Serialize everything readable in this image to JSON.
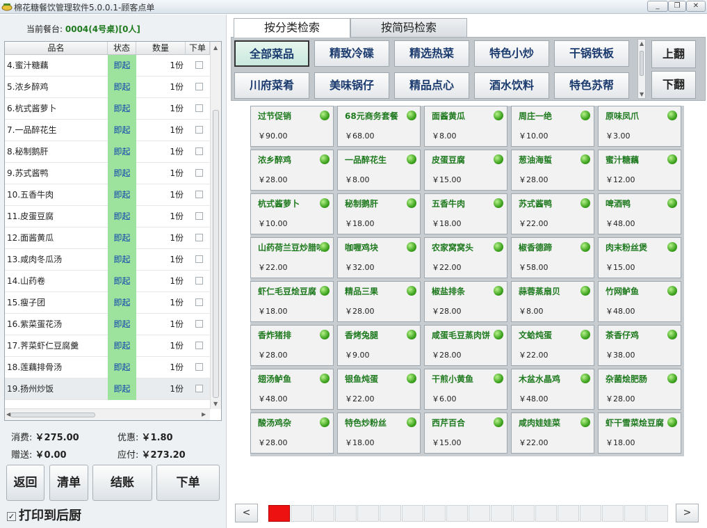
{
  "window": {
    "title": "棉花糖餐饮管理软件5.0.0.1-顾客点单",
    "minimize": "_",
    "restore": "❐",
    "close": "✕"
  },
  "order": {
    "table_label": "当前餐台:",
    "table_value": "0004(4号桌)[0人]",
    "columns": [
      "品名",
      "状态",
      "数量",
      "下单"
    ],
    "rows": [
      {
        "name": "4.蜜汁糖藕",
        "status": "即起",
        "qty": "1份"
      },
      {
        "name": "5.浓乡醉鸡",
        "status": "即起",
        "qty": "1份"
      },
      {
        "name": "6.杭式酱萝卜",
        "status": "即起",
        "qty": "1份"
      },
      {
        "name": "7.一品醉花生",
        "status": "即起",
        "qty": "1份"
      },
      {
        "name": "8.秘制鹅肝",
        "status": "即起",
        "qty": "1份"
      },
      {
        "name": "9.苏式酱鸭",
        "status": "即起",
        "qty": "1份"
      },
      {
        "name": "10.五香牛肉",
        "status": "即起",
        "qty": "1份"
      },
      {
        "name": "11.皮蛋豆腐",
        "status": "即起",
        "qty": "1份"
      },
      {
        "name": "12.面酱黄瓜",
        "status": "即起",
        "qty": "1份"
      },
      {
        "name": "13.咸肉冬瓜汤",
        "status": "即起",
        "qty": "1份"
      },
      {
        "name": "14.山药卷",
        "status": "即起",
        "qty": "1份"
      },
      {
        "name": "15.瘦子团",
        "status": "即起",
        "qty": "1份"
      },
      {
        "name": "16.紫菜蛋花汤",
        "status": "即起",
        "qty": "1份"
      },
      {
        "name": "17.荠菜虾仁豆腐羹",
        "status": "即起",
        "qty": "1份"
      },
      {
        "name": "18.莲藕排骨汤",
        "status": "即起",
        "qty": "1份"
      },
      {
        "name": "19.扬州炒饭",
        "status": "即起",
        "qty": "1份"
      }
    ]
  },
  "summary": {
    "consume_label": "消费:",
    "consume_value": "￥275.00",
    "discount_label": "优惠:",
    "discount_value": "￥1.80",
    "gift_label": "赠送:",
    "gift_value": "￥0.00",
    "payable_label": "应付:",
    "payable_value": "￥273.20"
  },
  "actions": {
    "back": "返回",
    "clear": "清单",
    "checkout": "结账",
    "submit": "下单"
  },
  "print": {
    "checked": true,
    "mark": "✓",
    "label": "打印到后厨"
  },
  "tabs": [
    {
      "label": "按分类检索",
      "active": true
    },
    {
      "label": "按简码检索",
      "active": false
    }
  ],
  "categories": [
    {
      "label": "全部菜品",
      "active": true
    },
    {
      "label": "精致冷碟",
      "active": false
    },
    {
      "label": "精选热菜",
      "active": false
    },
    {
      "label": "特色小炒",
      "active": false
    },
    {
      "label": "干锅铁板",
      "active": false
    },
    {
      "label": "川府菜肴",
      "active": false
    },
    {
      "label": "美味锅仔",
      "active": false
    },
    {
      "label": "精品点心",
      "active": false
    },
    {
      "label": "酒水饮料",
      "active": false
    },
    {
      "label": "特色苏帮",
      "active": false
    }
  ],
  "category_paging": {
    "up": "上翻",
    "down": "下翻"
  },
  "dishes": [
    {
      "name": "过节促销",
      "price": "￥90.00"
    },
    {
      "name": "68元商务套餐",
      "price": "￥68.00"
    },
    {
      "name": "面酱黄瓜",
      "price": "￥8.00"
    },
    {
      "name": "周庄一绝",
      "price": "￥10.00"
    },
    {
      "name": "原味凤爪",
      "price": "￥3.00"
    },
    {
      "name": "浓乡醉鸡",
      "price": "￥28.00"
    },
    {
      "name": "一品醉花生",
      "price": "￥8.00"
    },
    {
      "name": "皮蛋豆腐",
      "price": "￥15.00"
    },
    {
      "name": "葱油海蜇",
      "price": "￥28.00"
    },
    {
      "name": "蜜汁糖藕",
      "price": "￥12.00"
    },
    {
      "name": "杭式酱萝卜",
      "price": "￥10.00"
    },
    {
      "name": "秘制鹅肝",
      "price": "￥18.00"
    },
    {
      "name": "五香牛肉",
      "price": "￥18.00"
    },
    {
      "name": "苏式酱鸭",
      "price": "￥22.00"
    },
    {
      "name": "啤酒鸭",
      "price": "￥48.00"
    },
    {
      "name": "山药荷兰豆炒腊味",
      "price": "￥22.00"
    },
    {
      "name": "咖喱鸡块",
      "price": "￥32.00"
    },
    {
      "name": "农家窝窝头",
      "price": "￥22.00"
    },
    {
      "name": "椒香德蹄",
      "price": "￥58.00"
    },
    {
      "name": "肉末粉丝煲",
      "price": "￥15.00"
    },
    {
      "name": "虾仁毛豆烩豆腐",
      "price": "￥18.00"
    },
    {
      "name": "精品三果",
      "price": "￥28.00"
    },
    {
      "name": "椒盐排条",
      "price": "￥28.00"
    },
    {
      "name": "蒜蓉蒸扇贝",
      "price": "￥8.00"
    },
    {
      "name": "竹网鲈鱼",
      "price": "￥48.00"
    },
    {
      "name": "香炸猪排",
      "price": "￥28.00"
    },
    {
      "name": "香烤兔腿",
      "price": "￥9.00"
    },
    {
      "name": "咸蛋毛豆蒸肉饼",
      "price": "￥28.00"
    },
    {
      "name": "文蛤炖蛋",
      "price": "￥22.00"
    },
    {
      "name": "茶香仔鸡",
      "price": "￥38.00"
    },
    {
      "name": "翅汤鲈鱼",
      "price": "￥48.00"
    },
    {
      "name": "银鱼炖蛋",
      "price": "￥22.00"
    },
    {
      "name": "干煎小黄鱼",
      "price": "￥6.00"
    },
    {
      "name": "木盆水晶鸡",
      "price": "￥48.00"
    },
    {
      "name": "杂菌烩肥肠",
      "price": "￥28.00"
    },
    {
      "name": "酸汤鸡杂",
      "price": "￥28.00"
    },
    {
      "name": "特色炒粉丝",
      "price": "￥18.00"
    },
    {
      "name": "西芹百合",
      "price": "￥15.00"
    },
    {
      "name": "咸肉娃娃菜",
      "price": "￥22.00"
    },
    {
      "name": "虾干雪菜烩豆腐",
      "price": "￥18.00"
    }
  ],
  "pager": {
    "prev": "<",
    "next": ">",
    "current_page": 1,
    "page_count": 18
  },
  "colors": {
    "status_bg": "#9de39d",
    "dish_name": "#1f7a1f",
    "current_page": "#ee1111",
    "available_dot": "#3ea31f"
  }
}
